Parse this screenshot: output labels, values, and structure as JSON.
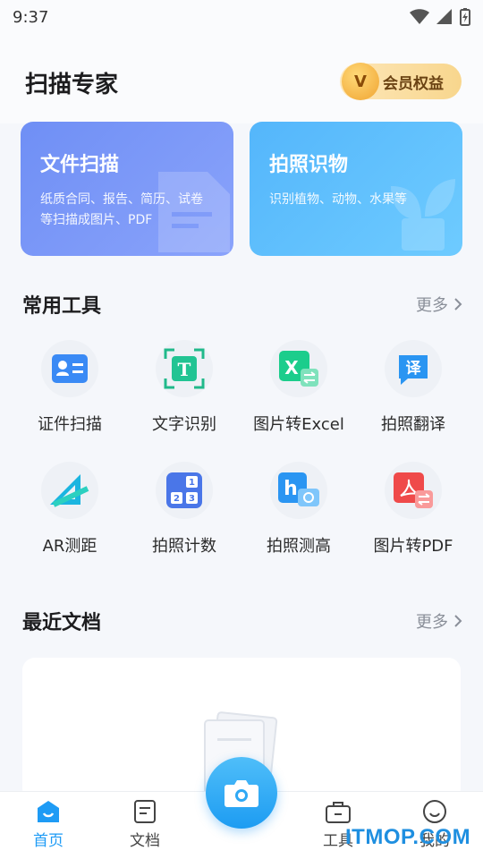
{
  "status_bar": {
    "time": "9:37"
  },
  "header": {
    "title": "扫描专家",
    "vip_label": "会员权益",
    "vip_badge": "V"
  },
  "hero_cards": [
    {
      "title": "文件扫描",
      "desc": "纸质合同、报告、简历、试卷等扫描成图片、PDF"
    },
    {
      "title": "拍照识物",
      "desc": "识别植物、动物、水果等"
    }
  ],
  "tools_section": {
    "title": "常用工具",
    "more": "更多"
  },
  "tools": [
    {
      "label": "证件扫描",
      "icon": "id-card-icon"
    },
    {
      "label": "文字识别",
      "icon": "text-recognition-icon",
      "glyph": "T"
    },
    {
      "label": "图片转Excel",
      "icon": "excel-icon",
      "glyph": "X"
    },
    {
      "label": "拍照翻译",
      "icon": "translate-icon",
      "glyph": "译"
    },
    {
      "label": "AR测距",
      "icon": "ruler-icon"
    },
    {
      "label": "拍照计数",
      "icon": "count-icon",
      "glyph": "123"
    },
    {
      "label": "拍照测高",
      "icon": "height-icon",
      "glyph": "h"
    },
    {
      "label": "图片转PDF",
      "icon": "pdf-icon"
    }
  ],
  "recent_section": {
    "title": "最近文档",
    "more": "更多"
  },
  "tab_bar": {
    "home": "首页",
    "docs": "文档",
    "tools": "工具",
    "mine": "我的"
  },
  "watermark": "ITMOP.COM",
  "colors": {
    "accent": "#1e9bf5",
    "vip": "#f8d68d"
  }
}
